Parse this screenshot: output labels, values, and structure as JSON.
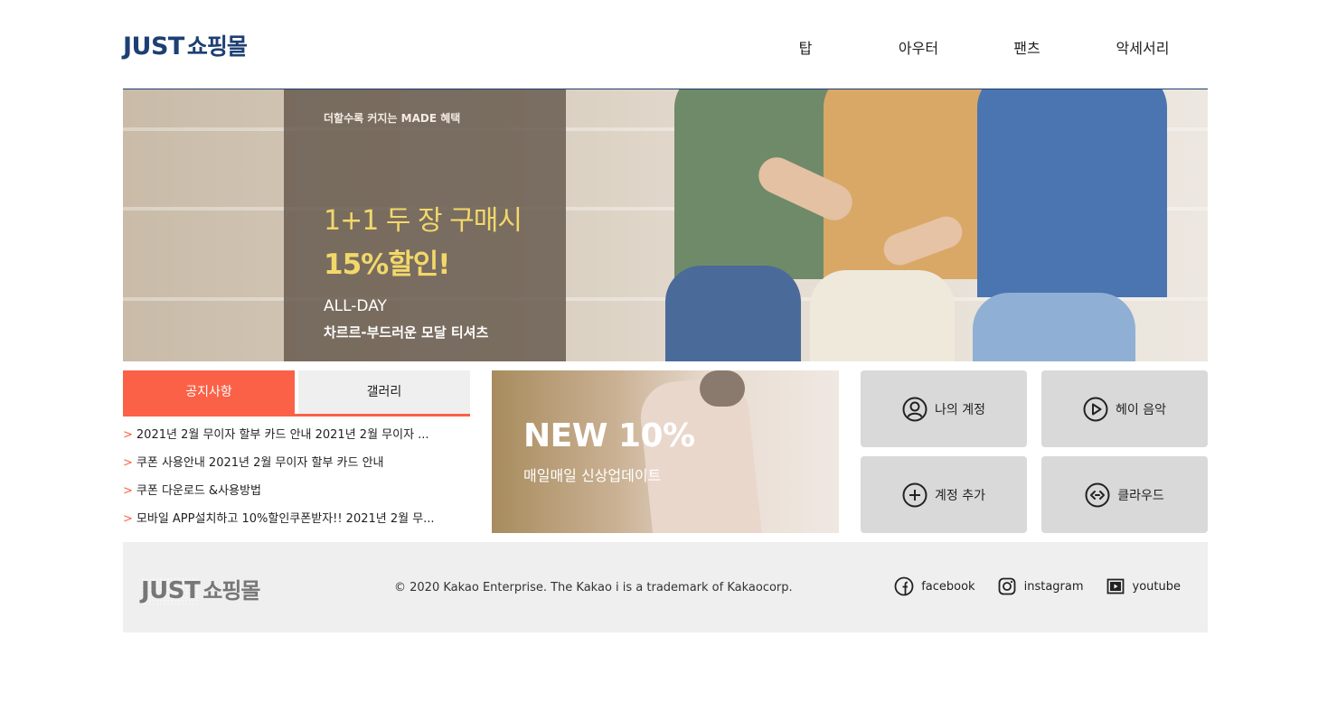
{
  "header": {
    "logo_en": "JUST",
    "logo_ko": "쇼핑몰",
    "nav": [
      "탑",
      "아우터",
      "팬츠",
      "악세서리"
    ]
  },
  "hero": {
    "tagline": "더할수록 커지는 MADE 혜택",
    "headline_1": "1+1 두 장 구매시",
    "headline_2": "15%할인!",
    "sub_1": "ALL-DAY",
    "sub_2": "차르르-부드러운 모달 티셔츠"
  },
  "notice": {
    "tabs": [
      {
        "label": "공지사항",
        "active": true
      },
      {
        "label": "갤러리",
        "active": false
      }
    ],
    "items": [
      "2021년 2월 무이자 할부 카드 안내 2021년 2월 무이자 ...",
      "쿠폰 사용안내 2021년 2월 무이자 할부 카드 안내",
      "쿠폰 다운로드 &사용방법",
      "모바일 APP설치하고 10%할인쿠폰받자!! 2021년 2월 무..."
    ]
  },
  "promo": {
    "title": "NEW 10%",
    "subtitle": "매일매일 신상업데이트"
  },
  "quick_links": [
    {
      "label": "나의 계정",
      "icon": "user-circle-icon"
    },
    {
      "label": "헤이 음악",
      "icon": "play-circle-icon"
    },
    {
      "label": "계정 추가",
      "icon": "plus-circle-icon"
    },
    {
      "label": "클라우드",
      "icon": "cloud-link-icon"
    }
  ],
  "footer": {
    "logo_en": "JUST",
    "logo_ko": "쇼핑몰",
    "copyright": "© 2020 Kakao Enterprise. The Kakao i is a trademark of Kakaocorp.",
    "social": [
      {
        "label": "facebook",
        "icon": "facebook-icon"
      },
      {
        "label": "instagram",
        "icon": "instagram-icon"
      },
      {
        "label": "youtube",
        "icon": "youtube-icon"
      }
    ]
  },
  "colors": {
    "brand": "#1d3f73",
    "accent": "#fb6147",
    "hero_highlight": "#f2d86a",
    "quick_bg": "#d9d9d9",
    "footer_bg": "#efefef"
  }
}
